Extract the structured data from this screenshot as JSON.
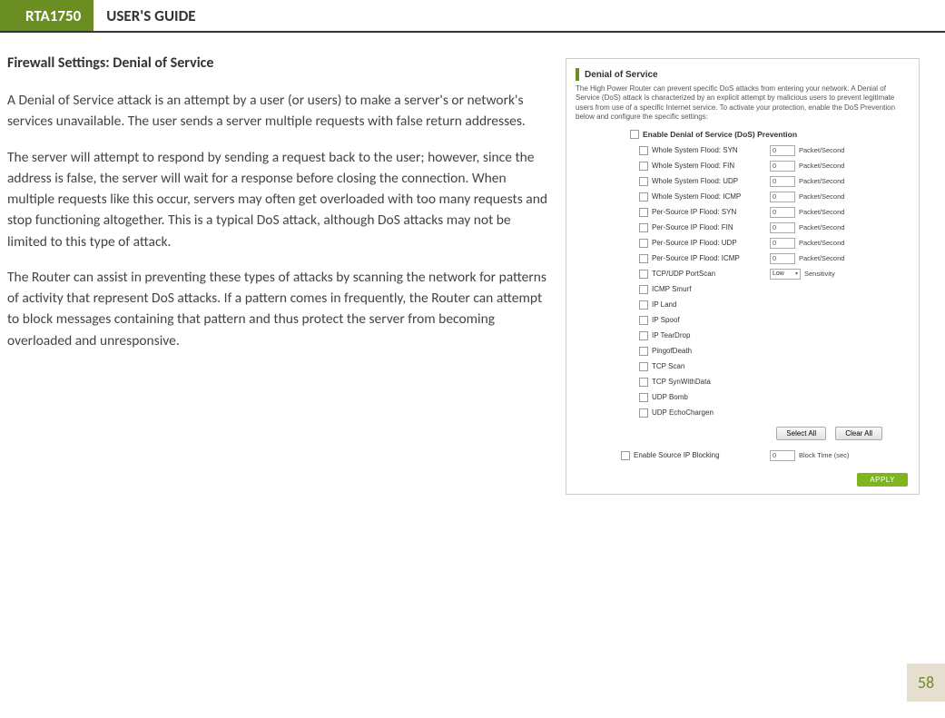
{
  "header": {
    "model": "RTA1750",
    "guide": "USER'S GUIDE"
  },
  "page": {
    "title": "Firewall Settings: Denial of Service",
    "p1": "A Denial of Service attack is an attempt by a user (or users) to make a server's or network's services unavailable. The user sends a server multiple requests with false return addresses.",
    "p2": "The server will attempt to respond by sending a request back to the user; however, since the address is false, the server will wait for a response before closing the connection. When multiple requests like this occur, servers may often get overloaded with too many requests and stop functioning altogether. This is a typical DoS attack, although DoS attacks may not be limited to this type of attack.",
    "p3": "The Router can assist in preventing these types of attacks by scanning the network for patterns of activity that represent DoS attacks. If a pattern comes in frequently, the Router can attempt to block messages containing that pattern and thus protect the server from becoming overloaded and unresponsive.",
    "number": "58"
  },
  "figure": {
    "section_title": "Denial of Service",
    "desc": "The High Power Router can prevent specific DoS attacks from entering your network. A Denial of Service (DoS) attack is characterized by an explicit attempt by malicious users to prevent legitimate users from use of a specific Internet service. To activate your protection, enable the DoS Prevention below and configure the specific settings:",
    "master": "Enable Denial of Service (DoS) Prevention",
    "rows_pkt": [
      {
        "label": "Whole System Flood: SYN",
        "val": "0",
        "unit": "Packet/Second"
      },
      {
        "label": "Whole System Flood: FIN",
        "val": "0",
        "unit": "Packet/Second"
      },
      {
        "label": "Whole System Flood: UDP",
        "val": "0",
        "unit": "Packet/Second"
      },
      {
        "label": "Whole System Flood: ICMP",
        "val": "0",
        "unit": "Packet/Second"
      },
      {
        "label": "Per-Source IP Flood: SYN",
        "val": "0",
        "unit": "Packet/Second"
      },
      {
        "label": "Per-Source IP Flood: FIN",
        "val": "0",
        "unit": "Packet/Second"
      },
      {
        "label": "Per-Source IP Flood: UDP",
        "val": "0",
        "unit": "Packet/Second"
      },
      {
        "label": "Per-Source IP Flood: ICMP",
        "val": "0",
        "unit": "Packet/Second"
      }
    ],
    "row_sens": {
      "label": "TCP/UDP PortScan",
      "sel": "Low",
      "unit": "Sensitivity"
    },
    "rows_plain": [
      "ICMP Smurf",
      "IP Land",
      "IP Spoof",
      "IP TearDrop",
      "PingofDeath",
      "TCP Scan",
      "TCP SynWithData",
      "UDP Bomb",
      "UDP EchoChargen"
    ],
    "btn_select": "Select All",
    "btn_clear": "Clear All",
    "row_block": {
      "label": "Enable Source IP Blocking",
      "val": "0",
      "unit": "Block Time (sec)"
    },
    "btn_apply": "APPLY"
  }
}
